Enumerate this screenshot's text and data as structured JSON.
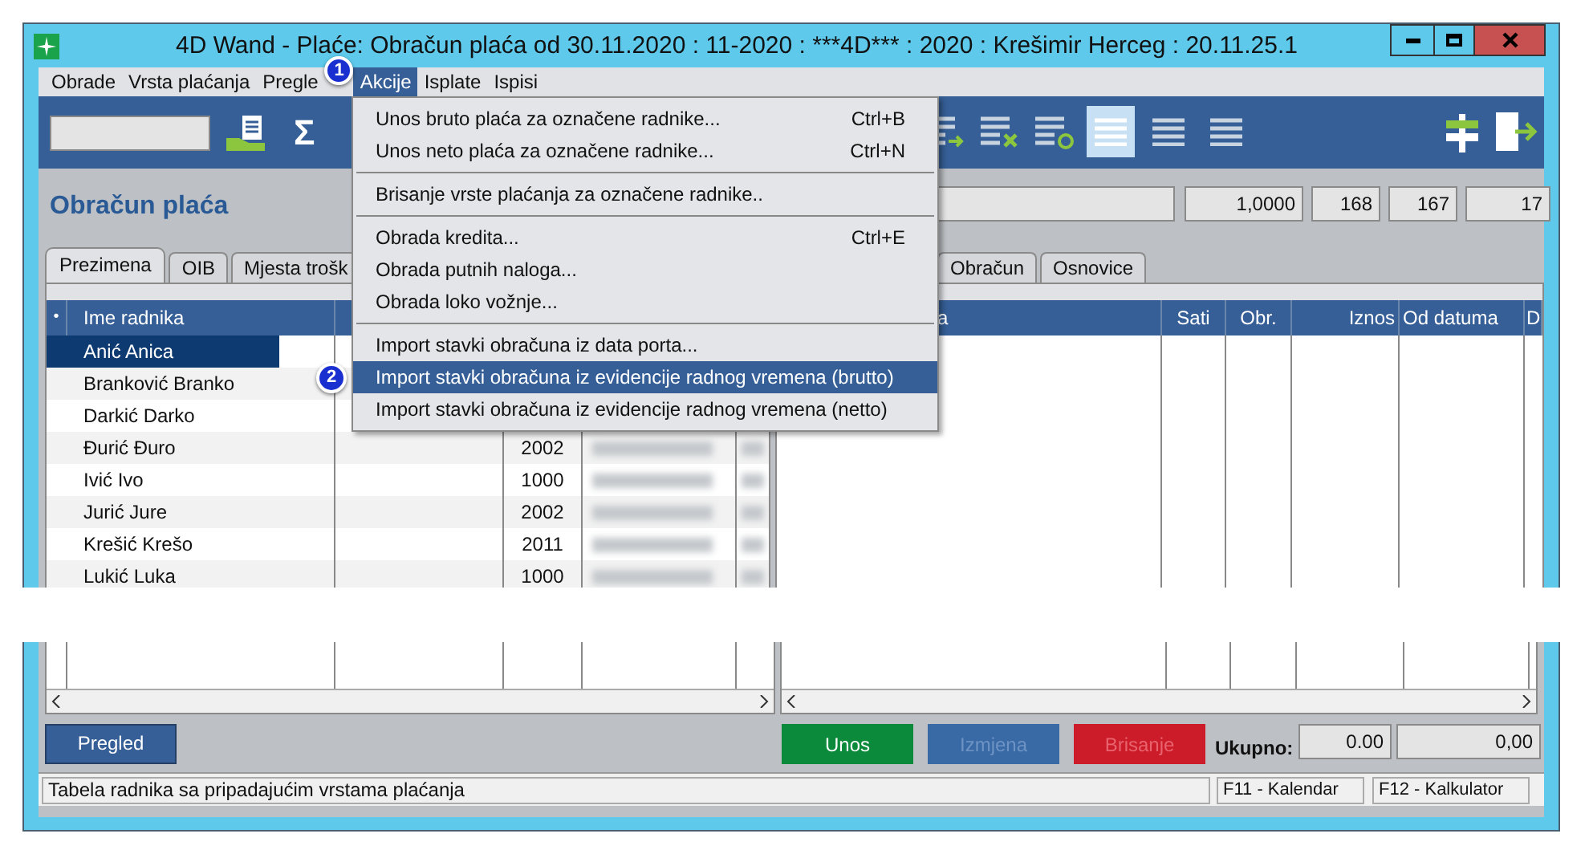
{
  "window": {
    "title": "4D Wand - Plaće: Obračun plaća od 30.11.2020 : 11-2020 : ***4D*** : 2020 : Krešimir Herceg : 20.11.25.1"
  },
  "menu_bar": [
    {
      "label": "Obrade",
      "selected": false
    },
    {
      "label": "Vrsta plaćanja",
      "selected": false
    },
    {
      "label": "Pregle",
      "selected": false
    },
    {
      "label": "Akcije",
      "selected": true
    },
    {
      "label": "Isplate",
      "selected": false
    },
    {
      "label": "Ispisi",
      "selected": false
    }
  ],
  "callouts": [
    "1",
    "2"
  ],
  "dropdown": [
    {
      "kind": "item",
      "label": "Unos bruto plaća za označene radnike...",
      "shortcut": "Ctrl+B",
      "selected": false
    },
    {
      "kind": "item",
      "label": "Unos neto plaća za označene radnike...",
      "shortcut": "Ctrl+N",
      "selected": false
    },
    {
      "kind": "separator"
    },
    {
      "kind": "item",
      "label": "Brisanje vrste plaćanja za označene radnike..",
      "selected": false
    },
    {
      "kind": "separator"
    },
    {
      "kind": "item",
      "label": "Obrada kredita...",
      "shortcut": "Ctrl+E",
      "selected": false
    },
    {
      "kind": "item",
      "label": "Obrada putnih naloga...",
      "selected": false
    },
    {
      "kind": "item",
      "label": "Obrada loko vožnje...",
      "selected": false
    },
    {
      "kind": "separator"
    },
    {
      "kind": "item",
      "label": "Import stavki obračuna iz data porta...",
      "selected": false
    },
    {
      "kind": "item",
      "label": "Import stavki obračuna iz evidencije radnog vremena (brutto)",
      "selected": true
    },
    {
      "kind": "item",
      "label": "Import stavki obračuna iz evidencije radnog vremena (netto)",
      "selected": false
    }
  ],
  "toolbar": {
    "sum_symbol": "Σ"
  },
  "view_modes": [
    {
      "selected": true
    },
    {
      "selected": false
    },
    {
      "selected": false
    }
  ],
  "heading": "Obračun plaća",
  "summary_fields": [
    "1,0000",
    "168",
    "167",
    "17"
  ],
  "left_tabs": [
    {
      "label": "Prezimena",
      "selected": true
    },
    {
      "label": "OIB",
      "selected": false
    },
    {
      "label": "Mjesta trošk",
      "selected": false
    }
  ],
  "right_tabs": [
    {
      "label": "Obračun",
      "selected": false
    },
    {
      "label": "Osnovice",
      "selected": false
    }
  ],
  "employees": {
    "marker": "•",
    "columns": [
      "Ime radnika"
    ],
    "rows": [
      {
        "name": "Anić Anica",
        "selected": true
      },
      {
        "name": "Branković Branko",
        "selected": false
      },
      {
        "name": "Darkić Darko",
        "selected": false
      },
      {
        "name": "Đurić Đuro",
        "code": "2002",
        "selected": false
      },
      {
        "name": "Ivić Ivo",
        "code": "1000",
        "selected": false
      },
      {
        "name": "Jurić Jure",
        "code": "2002",
        "selected": false
      },
      {
        "name": "Krešić Krešo",
        "code": "2011",
        "selected": false
      },
      {
        "name": "Lukić Luka",
        "code": "1000",
        "selected": false
      }
    ]
  },
  "entries": {
    "columns": [
      "a",
      "Sati",
      "Obr.",
      "Iznos",
      "Od datuma",
      "D"
    ]
  },
  "pregled_button": "Pregled",
  "action_buttons": [
    {
      "kind": "add",
      "label": "Unos",
      "disabled": false
    },
    {
      "kind": "edit",
      "label": "Izmjena",
      "disabled": true
    },
    {
      "kind": "delete",
      "label": "Brisanje",
      "disabled": true
    }
  ],
  "totals": {
    "label": "Ukupno:",
    "values": [
      "0.00",
      "0,00"
    ]
  },
  "status_bar": {
    "message": "Tabela radnika sa pripadajućim vrstama plaćanja",
    "keys": [
      "F11 - Kalendar",
      "F12 - Kalkulator"
    ]
  }
}
